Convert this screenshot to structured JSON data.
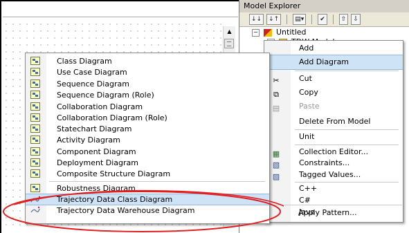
{
  "model_explorer": {
    "title": "Model Explorer",
    "toolbar": [
      "↓↓",
      "↓↑",
      "▤▾",
      "✔",
      "⇧",
      "⇩"
    ],
    "tree": [
      {
        "label": "Untitled",
        "icon": "cube-icon"
      },
      {
        "label": "TDW Model",
        "icon": "folder-icon"
      }
    ]
  },
  "context_menu": {
    "items": [
      {
        "id": "add",
        "label": "Add",
        "icon": "",
        "underline": 0
      },
      {
        "id": "add-diagram",
        "label": "Add Diagram",
        "icon": "",
        "selected": true
      },
      {
        "id": "cut",
        "label": "Cut",
        "icon": "scissors-icon"
      },
      {
        "id": "copy",
        "label": "Copy",
        "icon": "copy-icon"
      },
      {
        "id": "paste",
        "label": "Paste",
        "icon": "paste-icon",
        "disabled": true
      },
      {
        "id": "delete",
        "label": "Delete From Model",
        "icon": ""
      },
      {
        "id": "unit",
        "label": "Unit",
        "icon": ""
      },
      {
        "id": "collection-editor",
        "label": "Collection Editor...",
        "icon": "collection-icon"
      },
      {
        "id": "constraints",
        "label": "Constraints...",
        "icon": "constraints-icon"
      },
      {
        "id": "tagged-values",
        "label": "Tagged Values...",
        "icon": "tagged-values-icon"
      },
      {
        "id": "cpp",
        "label": "C++",
        "icon": ""
      },
      {
        "id": "csharp",
        "label": "C#",
        "icon": ""
      },
      {
        "id": "java",
        "label": "Java",
        "icon": ""
      },
      {
        "id": "apply-pattern",
        "label": "Apply Pattern...",
        "icon": ""
      }
    ]
  },
  "diagram_submenu": {
    "items": [
      {
        "label": "Class Diagram",
        "icon": "class-diagram-icon"
      },
      {
        "label": "Use Case Diagram",
        "icon": "use-case-diagram-icon"
      },
      {
        "label": "Sequence Diagram",
        "icon": "sequence-diagram-icon"
      },
      {
        "label": "Sequence Diagram (Role)",
        "icon": "sequence-role-diagram-icon"
      },
      {
        "label": "Collaboration Diagram",
        "icon": "collaboration-diagram-icon"
      },
      {
        "label": "Collaboration Diagram (Role)",
        "icon": "collaboration-role-diagram-icon"
      },
      {
        "label": "Statechart Diagram",
        "icon": "statechart-diagram-icon"
      },
      {
        "label": "Activity Diagram",
        "icon": "activity-diagram-icon"
      },
      {
        "label": "Component Diagram",
        "icon": "component-diagram-icon"
      },
      {
        "label": "Deployment Diagram",
        "icon": "deployment-diagram-icon"
      },
      {
        "label": "Composite Structure Diagram",
        "icon": "composite-structure-diagram-icon"
      },
      {
        "label": "Robustness Diagram",
        "icon": "robustness-diagram-icon"
      },
      {
        "label": "Trajectory Data Class Diagram",
        "icon": "trajectory-class-diagram-icon",
        "selected": true
      },
      {
        "label": "Trajectory Data Warehouse Diagram",
        "icon": "trajectory-warehouse-diagram-icon"
      }
    ]
  },
  "colors": {
    "highlight": "#cfe3f7",
    "highlight_border": "#8eb7e2",
    "annotation": "#e02020"
  }
}
